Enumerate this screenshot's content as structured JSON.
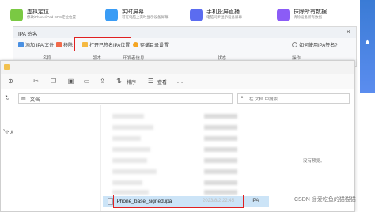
{
  "features": [
    {
      "title": "虚拟定位",
      "desc": "修改iPhone/iPad GPS定位位置",
      "color": "#7ac943",
      "icon": "location-icon"
    },
    {
      "title": "实时屏幕",
      "desc": "可在电脑上实时显示设备屏幕",
      "color": "#3a9cf5",
      "icon": "screen-icon"
    },
    {
      "title": "手机投屏直播",
      "desc": "电脑同步显示设备屏幕",
      "color": "#5b6cf0",
      "icon": "cast-icon"
    },
    {
      "title": "抹除所有数据",
      "desc": "清除设备所有数据",
      "color": "#8b5cf6",
      "icon": "erase-icon"
    }
  ],
  "ipa_window": {
    "title": "IPA 签名",
    "close": "✕",
    "toolbar": {
      "add": "添加 IPA 文件",
      "remove": "移除",
      "open_signed": "打开已签名IPA位置",
      "save_settings": "存储目录设置",
      "help": "如何使用IPA签名?"
    },
    "columns": [
      "名称",
      "版本",
      "开发者信息",
      "状态",
      "操作"
    ]
  },
  "explorer": {
    "sort": "排序",
    "view": "查看",
    "path": "文档",
    "search_placeholder": "在 文档 中搜索",
    "nav_personal": "个人",
    "file": {
      "name": "iPhone_base_signed.ipa",
      "date": "2023/8/2 22:45",
      "type": "IPA"
    },
    "preview": "没有预览。"
  },
  "watermark": "CSDN @爱吃鱼的猫猫猫"
}
